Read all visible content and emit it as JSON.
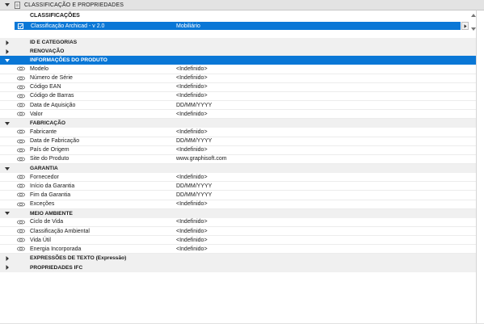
{
  "header": {
    "title": "CLASSIFICAÇÃO E PROPRIEDADES"
  },
  "classifications": {
    "title": "CLASSIFICAÇÕES",
    "row": {
      "name": "Classificação Archicad - v 2.0",
      "value": "Mobiliário"
    }
  },
  "tree": [
    {
      "type": "group",
      "label": "ID E CATEGORIAS",
      "expanded": false
    },
    {
      "type": "group",
      "label": "RENOVAÇÃO",
      "expanded": false
    },
    {
      "type": "group",
      "label": "INFORMAÇÕES DO PRODUTO",
      "expanded": true,
      "selected": true
    },
    {
      "type": "item",
      "label": "Modelo",
      "value": "<Indefinido>"
    },
    {
      "type": "item",
      "label": "Número de Série",
      "value": "<Indefinido>"
    },
    {
      "type": "item",
      "label": "Código EAN",
      "value": "<Indefinido>"
    },
    {
      "type": "item",
      "label": "Código de Barras",
      "value": "<Indefinido>"
    },
    {
      "type": "item",
      "label": "Data de Aquisição",
      "value": "DD/MM/YYYY"
    },
    {
      "type": "item",
      "label": "Valor",
      "value": "<Indefinido>"
    },
    {
      "type": "group",
      "label": "FABRICAÇÃO",
      "expanded": true
    },
    {
      "type": "item",
      "label": "Fabricante",
      "value": "<Indefinido>"
    },
    {
      "type": "item",
      "label": "Data de Fabricação",
      "value": "DD/MM/YYYY"
    },
    {
      "type": "item",
      "label": "País de Origem",
      "value": "<Indefinido>"
    },
    {
      "type": "item",
      "label": "Site do Produto",
      "value": "www.graphisoft.com"
    },
    {
      "type": "group",
      "label": "GARANTIA",
      "expanded": true
    },
    {
      "type": "item",
      "label": "Fornecedor",
      "value": "<Indefinido>"
    },
    {
      "type": "item",
      "label": "Início da Garantia",
      "value": "DD/MM/YYYY"
    },
    {
      "type": "item",
      "label": "Fim da Garantia",
      "value": "DD/MM/YYYY"
    },
    {
      "type": "item",
      "label": "Exceções",
      "value": "<Indefinido>"
    },
    {
      "type": "group",
      "label": "MEIO AMBIENTE",
      "expanded": true
    },
    {
      "type": "item",
      "label": "Ciclo de Vida",
      "value": "<Indefinido>"
    },
    {
      "type": "item",
      "label": "Classificação Ambiental",
      "value": "<Indefinido>"
    },
    {
      "type": "item",
      "label": "Vida Útil",
      "value": "<Indefinido>"
    },
    {
      "type": "item",
      "label": "Energia Incorporada",
      "value": "<Indefinido>"
    },
    {
      "type": "group",
      "label": "EXPRESSÕES DE TEXTO (Expressão)",
      "expanded": false
    },
    {
      "type": "group",
      "label": "PROPRIEDADES IFC",
      "expanded": false
    }
  ],
  "colors": {
    "accent": "#0a77d6",
    "group_bg": "#f0f0f0",
    "header_bg": "#e3e3e3"
  },
  "icons": {
    "header_caret": "caret-down-icon",
    "header_doc": "document-icon",
    "checkbox": "check-icon",
    "row_arrow": "chevron-right-icon",
    "item_eye": "eye-link-icon"
  }
}
